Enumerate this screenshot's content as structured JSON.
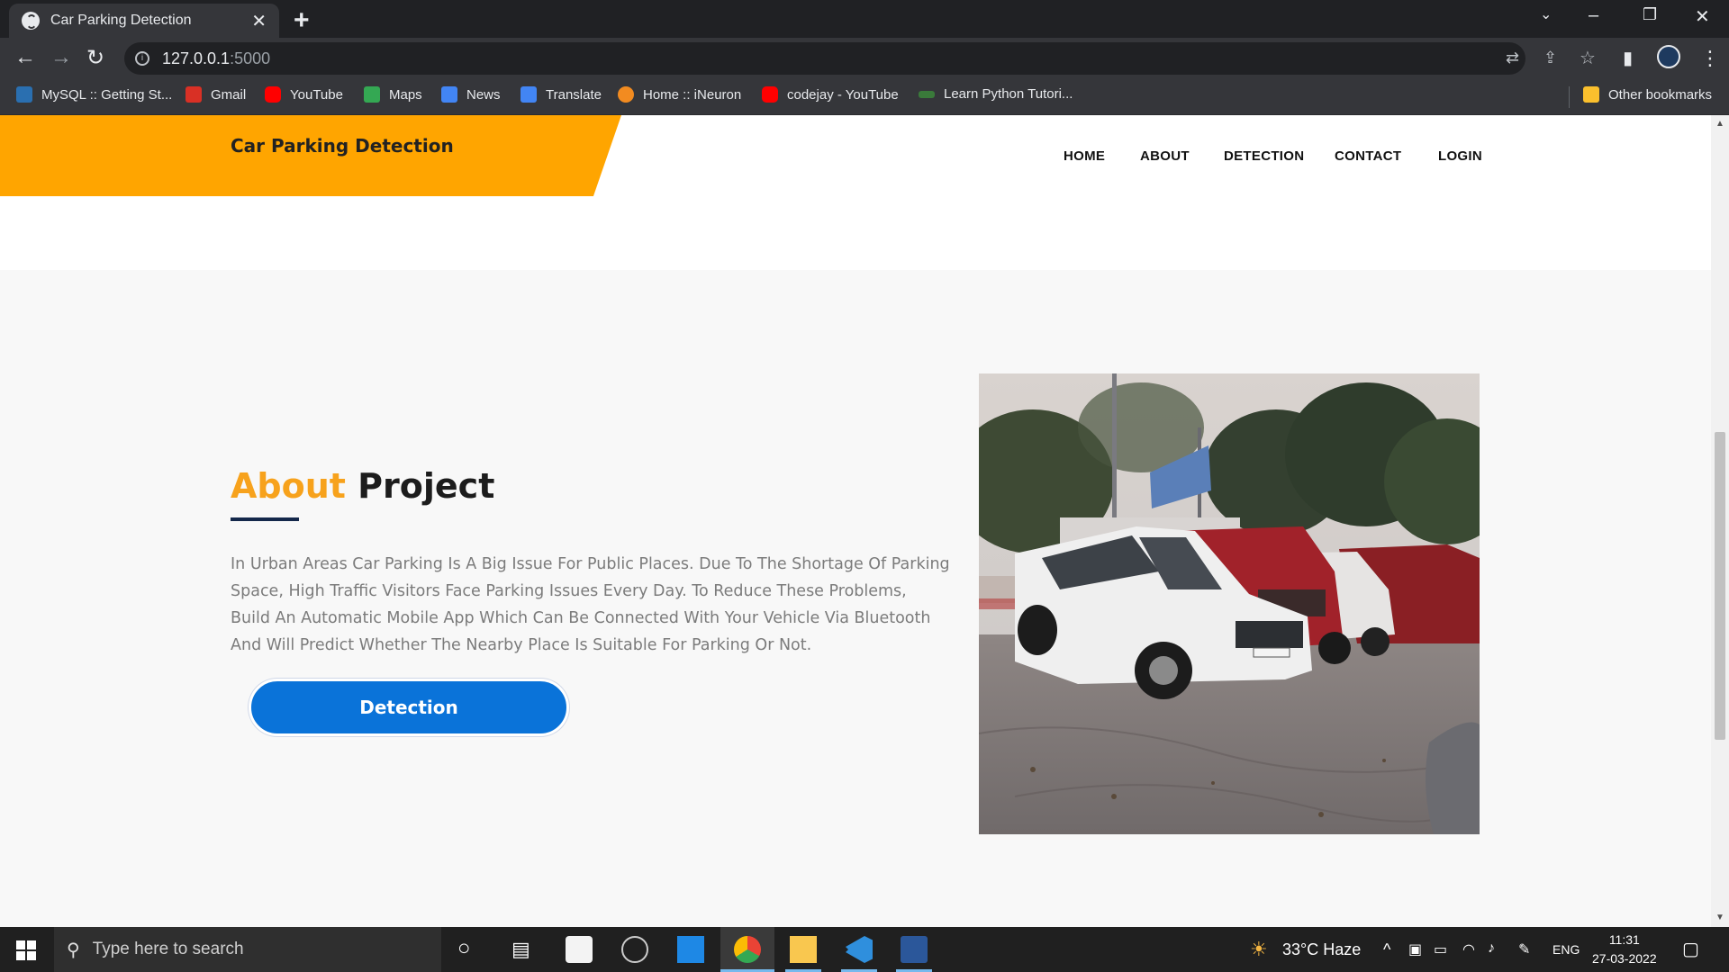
{
  "browser": {
    "tab_title": "Car Parking Detection",
    "url_host": "127.0.0.1",
    "url_port": ":5000",
    "bookmarks": [
      "MySQL :: Getting St...",
      "Gmail",
      "YouTube",
      "Maps",
      "News",
      "Translate",
      "Home :: iNeuron",
      "codejay - YouTube",
      "Learn Python Tutori..."
    ],
    "other_bookmarks": "Other bookmarks"
  },
  "site": {
    "brand": "Car Parking Detection",
    "nav": [
      "HOME",
      "ABOUT",
      "DETECTION",
      "CONTACT",
      "LOGIN"
    ]
  },
  "about": {
    "title_part1": "About",
    "title_part2": "Project",
    "text": "In Urban Areas Car Parking Is A Big Issue For Public Places. Due To The Shortage Of Parking Space, High Traffic Visitors Face Parking Issues Every Day. To Reduce These Problems, Build An Automatic Mobile App Which Can Be Connected With Your Vehicle Via Bluetooth And Will Predict Whether The Nearby Place Is Suitable For Parking Or Not.",
    "button": "Detection"
  },
  "taskbar": {
    "search_placeholder": "Type here to search",
    "weather": "33°C  Haze",
    "lang": "ENG",
    "time": "11:31",
    "date": "27-03-2022"
  },
  "colors": {
    "accent_orange": "#ffa500",
    "button_blue": "#0a73d9",
    "chrome_dark": "#202124"
  }
}
